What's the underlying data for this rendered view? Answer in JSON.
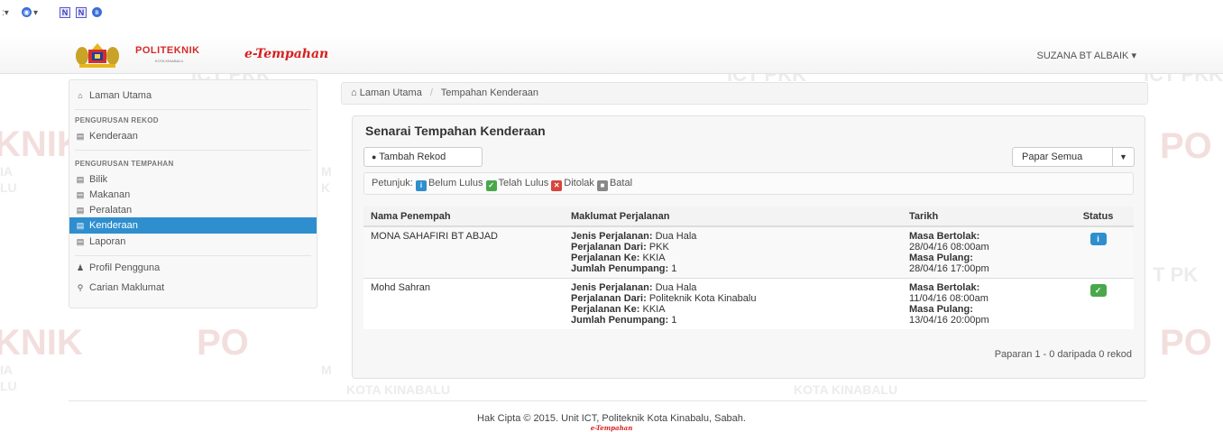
{
  "browser": {
    "icons": [
      {
        "name": "dropdown-icon",
        "label": ":▾"
      },
      {
        "name": "globe-icon",
        "label": "▾"
      },
      {
        "name": "n-icon",
        "label": "N"
      },
      {
        "name": "n2-icon",
        "label": "N"
      },
      {
        "name": "bluetooth-icon",
        "label": "ʙ"
      }
    ]
  },
  "watermarks": {
    "ict_pkk": "ICT PKK",
    "politeknik": "POLITEKNIK",
    "kota_kinabalu": "KOTA KINABALU",
    "ia": "IA",
    "lu": "LU",
    "m": "M",
    "k": "K",
    "t_pk": "T PK",
    "po": "PO",
    "knik": "KNIK"
  },
  "navbar": {
    "logo_text": "POLITEKNIK",
    "logo_sub": "KOTA KINABALU",
    "brand": "e-Tempahan",
    "user": "SUZANA BT ALBAIK",
    "user_caret": "▾"
  },
  "sidebar": {
    "home": "Laman Utama",
    "section1": "PENGURUSAN REKOD",
    "s1_items": [
      "Kenderaan"
    ],
    "section2": "PENGURUSAN TEMPAHAN",
    "s2_items": [
      "Bilik",
      "Makanan",
      "Peralatan",
      "Kenderaan",
      "Laporan"
    ],
    "active_item": "Kenderaan",
    "profile": "Profil Pengguna",
    "search": "Carian Maklumat"
  },
  "breadcrumb": {
    "home": "Laman Utama",
    "separator": "/",
    "current": "Tempahan Kenderaan"
  },
  "panel": {
    "title": "Senarai Tempahan Kenderaan",
    "add_button": "Tambah Rekod",
    "view_button": "Papar Semua",
    "legend_label": "Petunjuk:",
    "legend": [
      {
        "label": "Belum Lulus",
        "color": "#2f8fce",
        "icon": "info-icon"
      },
      {
        "label": "Telah Lulus",
        "color": "#4aa84a",
        "icon": "check-icon"
      },
      {
        "label": "Ditolak",
        "color": "#d9443c",
        "icon": "x-icon"
      },
      {
        "label": "Batal",
        "color": "#888888",
        "icon": "square-icon"
      }
    ],
    "columns": [
      "Nama Penempah",
      "Maklumat Perjalanan",
      "Tarikh",
      "Status"
    ],
    "labels": {
      "jenis": "Jenis Perjalanan:",
      "dari": "Perjalanan Dari:",
      "ke": "Perjalanan Ke:",
      "jumlah": "Jumlah Penumpang:",
      "bertolak": "Masa Bertolak:",
      "pulang": "Masa Pulang:"
    },
    "rows": [
      {
        "nama": "MONA SAHAFIRI BT ABJAD",
        "jenis": "Dua Hala",
        "dari": "PKK",
        "ke": "KKIA",
        "jumlah": "1",
        "bertolak": "28/04/16 08:00am",
        "pulang": "28/04/16 17:00pm",
        "status": "Belum Lulus",
        "status_color": "#2f8fce",
        "status_icon": "info-icon"
      },
      {
        "nama": "Mohd Sahran",
        "jenis": "Dua Hala",
        "dari": "Politeknik Kota Kinabalu",
        "ke": "KKIA",
        "jumlah": "1",
        "bertolak": "11/04/16 08:00am",
        "pulang": "13/04/16 20:00pm",
        "status": "Telah Lulus",
        "status_color": "#4aa84a",
        "status_icon": "check-icon"
      }
    ],
    "footer": "Paparan 1 - 0 daripada 0 rekod"
  },
  "footer": {
    "copyright": "Hak Cipta © 2015. Unit ICT, Politeknik Kota Kinabalu, Sabah.",
    "brand": "e-Tempahan"
  }
}
